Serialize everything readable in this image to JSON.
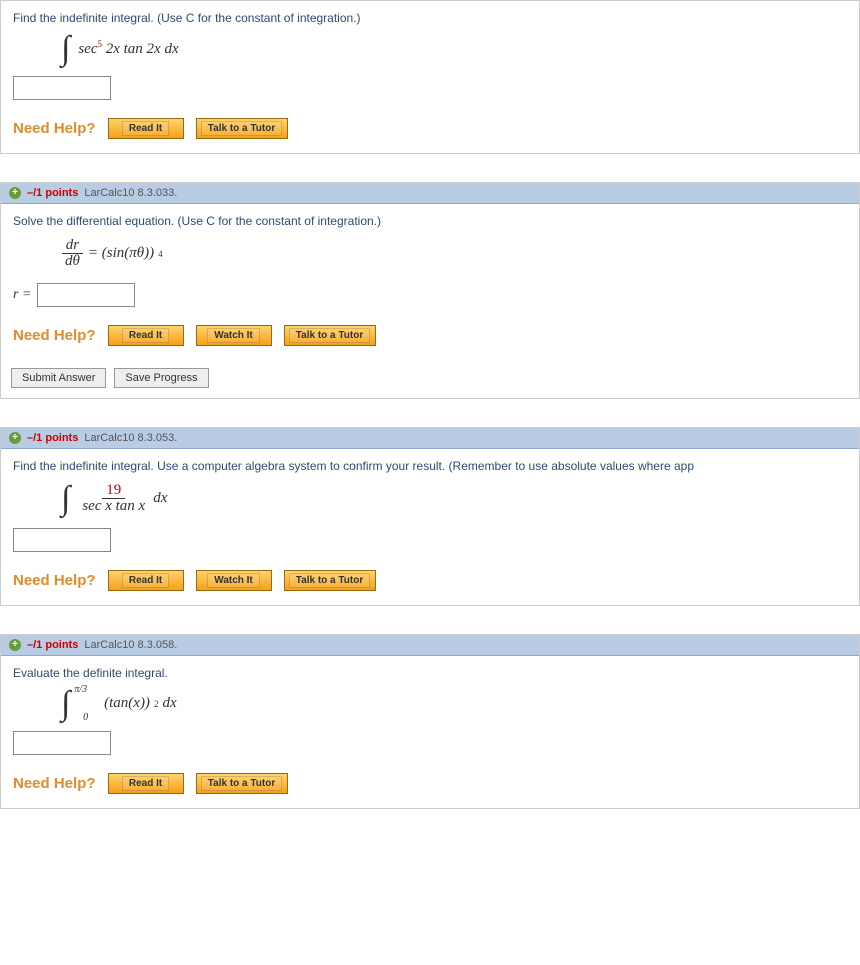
{
  "help_label": "Need Help?",
  "btn_read": "Read It",
  "btn_watch": "Watch It",
  "btn_tutor": "Talk to a Tutor",
  "btn_submit": "Submit Answer",
  "btn_save": "Save Progress",
  "q1": {
    "prompt": "Find the indefinite integral. (Use C for the constant of integration.)",
    "expr_a": "sec",
    "expr_pow": "5",
    "expr_b": " 2x tan 2x dx"
  },
  "q2": {
    "points": "–/1 points",
    "ref": "LarCalc10 8.3.033.",
    "prompt": "Solve the differential equation. (Use C for the constant of integration.)",
    "lhs_num": "dr",
    "lhs_den": "dθ",
    "eq": " = (sin(πθ))",
    "pow": "4",
    "rvar": "r ="
  },
  "q3": {
    "points": "–/1 points",
    "ref": "LarCalc10 8.3.053.",
    "prompt": "Find the indefinite integral. Use a computer algebra system to confirm your result. (Remember to use absolute values where app",
    "num": "19",
    "den": "sec x tan x",
    "dx": " dx"
  },
  "q4": {
    "points": "–/1 points",
    "ref": "LarCalc10 8.3.058.",
    "prompt": "Evaluate the definite integral.",
    "upper": "π/3",
    "lower": "0",
    "body": "(tan(x))",
    "pow": "2",
    "dx": " dx"
  }
}
